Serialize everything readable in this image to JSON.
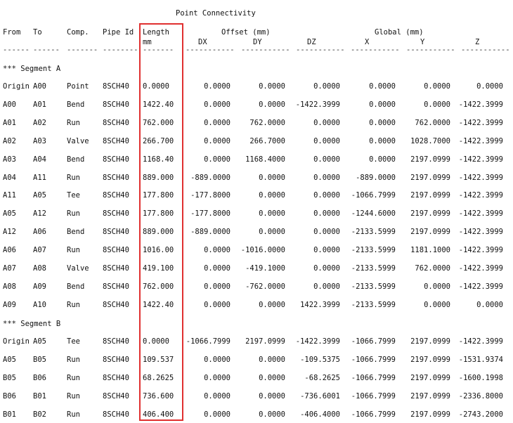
{
  "title": "Point Connectivity",
  "headers": {
    "from": "From",
    "to": "To",
    "comp": "Comp.",
    "pipe_id": "Pipe Id",
    "length": "Length",
    "length_unit": "mm",
    "offset": "Offset (mm)",
    "global": "Global (mm)",
    "dx": "DX",
    "dy": "DY",
    "dz": "DZ",
    "x": "X",
    "y": "Y",
    "z": "Z"
  },
  "separator": {
    "from": "------",
    "to": "------",
    "comp": "-------",
    "pipe_id": "--------",
    "length": "-------",
    "dx": "-----------",
    "dy": "-----------",
    "dz": "-----------",
    "x": "-----------",
    "y": "-----------",
    "z": "-----------"
  },
  "segments": [
    {
      "label": "*** Segment A",
      "rows": [
        [
          "Origin",
          "A00",
          "Point",
          "8SCH40",
          "0.0000",
          "0.0000",
          "0.0000",
          "0.0000",
          "0.0000",
          "0.0000",
          "0.0000"
        ],
        [
          "A00",
          "A01",
          "Bend",
          "8SCH40",
          "1422.40",
          "0.0000",
          "0.0000",
          "-1422.3999",
          "0.0000",
          "0.0000",
          "-1422.3999"
        ],
        [
          "A01",
          "A02",
          "Run",
          "8SCH40",
          "762.000",
          "0.0000",
          "762.0000",
          "0.0000",
          "0.0000",
          "762.0000",
          "-1422.3999"
        ],
        [
          "A02",
          "A03",
          "Valve",
          "8SCH40",
          "266.700",
          "0.0000",
          "266.7000",
          "0.0000",
          "0.0000",
          "1028.7000",
          "-1422.3999"
        ],
        [
          "A03",
          "A04",
          "Bend",
          "8SCH40",
          "1168.40",
          "0.0000",
          "1168.4000",
          "0.0000",
          "0.0000",
          "2197.0999",
          "-1422.3999"
        ],
        [
          "A04",
          "A11",
          "Run",
          "8SCH40",
          "889.000",
          "-889.0000",
          "0.0000",
          "0.0000",
          "-889.0000",
          "2197.0999",
          "-1422.3999"
        ],
        [
          "A11",
          "A05",
          "Tee",
          "8SCH40",
          "177.800",
          "-177.8000",
          "0.0000",
          "0.0000",
          "-1066.7999",
          "2197.0999",
          "-1422.3999"
        ],
        [
          "A05",
          "A12",
          "Run",
          "8SCH40",
          "177.800",
          "-177.8000",
          "0.0000",
          "0.0000",
          "-1244.6000",
          "2197.0999",
          "-1422.3999"
        ],
        [
          "A12",
          "A06",
          "Bend",
          "8SCH40",
          "889.000",
          "-889.0000",
          "0.0000",
          "0.0000",
          "-2133.5999",
          "2197.0999",
          "-1422.3999"
        ],
        [
          "A06",
          "A07",
          "Run",
          "8SCH40",
          "1016.00",
          "0.0000",
          "-1016.0000",
          "0.0000",
          "-2133.5999",
          "1181.1000",
          "-1422.3999"
        ],
        [
          "A07",
          "A08",
          "Valve",
          "8SCH40",
          "419.100",
          "0.0000",
          "-419.1000",
          "0.0000",
          "-2133.5999",
          "762.0000",
          "-1422.3999"
        ],
        [
          "A08",
          "A09",
          "Bend",
          "8SCH40",
          "762.000",
          "0.0000",
          "-762.0000",
          "0.0000",
          "-2133.5999",
          "0.0000",
          "-1422.3999"
        ],
        [
          "A09",
          "A10",
          "Run",
          "8SCH40",
          "1422.40",
          "0.0000",
          "0.0000",
          "1422.3999",
          "-2133.5999",
          "0.0000",
          "0.0000"
        ]
      ]
    },
    {
      "label": "*** Segment B",
      "rows": [
        [
          "Origin",
          "A05",
          "Tee",
          "8SCH40",
          "0.0000",
          "-1066.7999",
          "2197.0999",
          "-1422.3999",
          "-1066.7999",
          "2197.0999",
          "-1422.3999"
        ],
        [
          "A05",
          "B05",
          "Run",
          "8SCH40",
          "109.537",
          "0.0000",
          "0.0000",
          "-109.5375",
          "-1066.7999",
          "2197.0999",
          "-1531.9374"
        ],
        [
          "B05",
          "B06",
          "Run",
          "8SCH40",
          "68.2625",
          "0.0000",
          "0.0000",
          "-68.2625",
          "-1066.7999",
          "2197.0999",
          "-1600.1998"
        ],
        [
          "B06",
          "B01",
          "Run",
          "8SCH40",
          "736.600",
          "0.0000",
          "0.0000",
          "-736.6001",
          "-1066.7999",
          "2197.0999",
          "-2336.8000"
        ],
        [
          "B01",
          "B02",
          "Run",
          "8SCH40",
          "406.400",
          "0.0000",
          "0.0000",
          "-406.4000",
          "-1066.7999",
          "2197.0999",
          "-2743.2000"
        ]
      ]
    }
  ]
}
